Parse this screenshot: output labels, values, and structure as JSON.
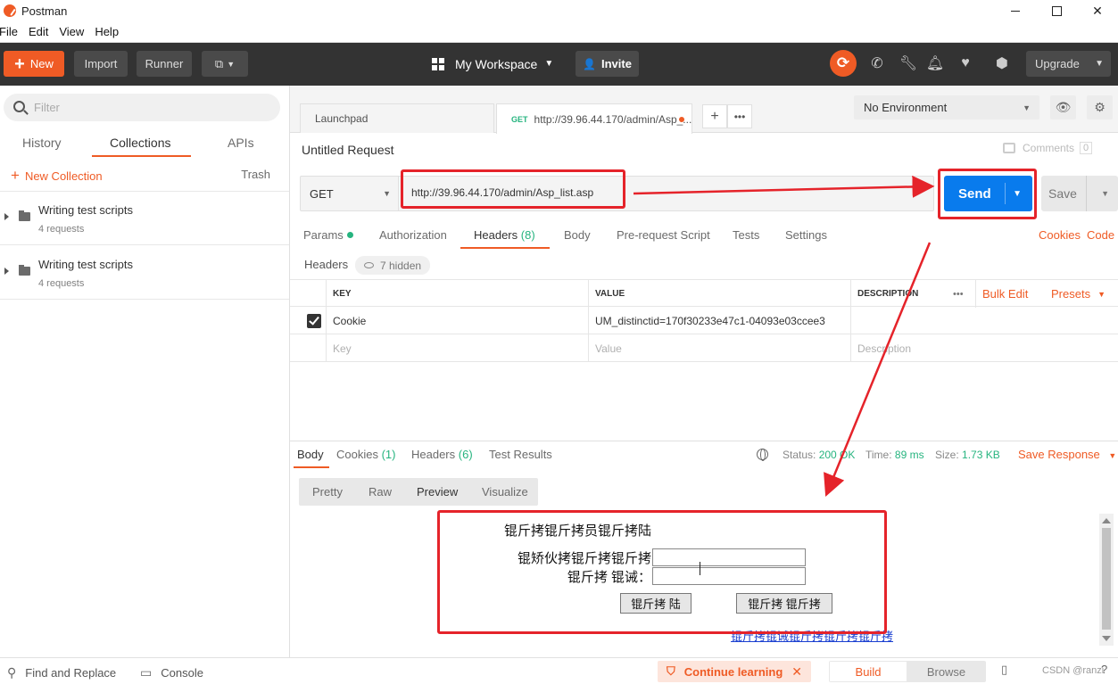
{
  "window": {
    "title": "Postman"
  },
  "menu": [
    "File",
    "Edit",
    "View",
    "Help"
  ],
  "toolbar": {
    "new_label": "New",
    "import_label": "Import",
    "runner_label": "Runner",
    "workspace_label": "My Workspace",
    "invite_label": "Invite",
    "upgrade_label": "Upgrade"
  },
  "sidebar": {
    "filter_placeholder": "Filter",
    "tabs": [
      "History",
      "Collections",
      "APIs"
    ],
    "active_tab": "Collections",
    "new_collection_label": "New Collection",
    "trash_label": "Trash",
    "collections": [
      {
        "name": "Writing test scripts",
        "sub": "4 requests"
      },
      {
        "name": "Writing test scripts",
        "sub": "4 requests"
      }
    ]
  },
  "tabs": {
    "launchpad": "Launchpad",
    "active_method": "GET",
    "active_title": "http://39.96.44.170/admin/Asp_..."
  },
  "environment": {
    "selected": "No Environment"
  },
  "request": {
    "title": "Untitled Request",
    "comments_label": "Comments",
    "comments_count": "0",
    "method": "GET",
    "url": "http://39.96.44.170/admin/Asp_list.asp",
    "send_label": "Send",
    "save_label": "Save",
    "tabs": {
      "params": "Params",
      "authorization": "Authorization",
      "headers": "Headers",
      "headers_count": "(8)",
      "body": "Body",
      "prerequest": "Pre-request Script",
      "tests": "Tests",
      "settings": "Settings"
    },
    "cookies_link": "Cookies",
    "code_link": "Code"
  },
  "headers": {
    "label": "Headers",
    "hidden_label": "7 hidden",
    "col_key": "KEY",
    "col_value": "VALUE",
    "col_description": "DESCRIPTION",
    "more": "•••",
    "bulk_edit": "Bulk Edit",
    "presets": "Presets",
    "rows": [
      {
        "key": "Cookie",
        "value": "UM_distinctid=170f30233e47c1-04093e03ccee3",
        "checked": true
      }
    ],
    "placeholder_key": "Key",
    "placeholder_value": "Value",
    "placeholder_description": "Description"
  },
  "response": {
    "tabs": {
      "body": "Body",
      "cookies": "Cookies",
      "cookies_count": "(1)",
      "headers": "Headers",
      "headers_count": "(6)",
      "test_results": "Test Results"
    },
    "status_label": "Status:",
    "status_value": "200 OK",
    "time_label": "Time:",
    "time_value": "89 ms",
    "size_label": "Size:",
    "size_value": "1.73 KB",
    "save_response": "Save Response",
    "view_modes": [
      "Pretty",
      "Raw",
      "Preview",
      "Visualize"
    ],
    "active_view": "Preview",
    "preview": {
      "title": "锟斤拷锟斤拷员锟斤拷陆",
      "user_label": "锟矫伙拷锟斤拷锟斤拷",
      "pass_label": "锟斤拷 锟诫：",
      "btn_login": "锟斤拷 陆",
      "btn_reset": "锟斤拷 锟斤拷",
      "link": "锟斤拷锟诫锟斤拷锟斤拷锟斤拷"
    }
  },
  "statusbar": {
    "find_replace": "Find and Replace",
    "console": "Console",
    "continue_learning": "Continue learning",
    "build": "Build",
    "browse": "Browse",
    "watermark": "CSDN @ranzi"
  },
  "colors": {
    "accent": "#ef5b25",
    "send_blue": "#097bed",
    "annotation_red": "#e5232a",
    "success_green": "#26b47f"
  }
}
